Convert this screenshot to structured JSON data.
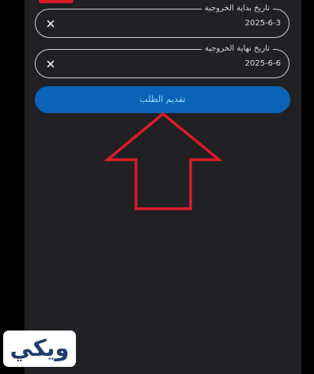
{
  "form": {
    "start_date": {
      "label": "تاريخ بداية الخروجية",
      "value": "2025-6-3",
      "clear_icon": "close-icon"
    },
    "end_date": {
      "label": "تاريخ نهاية الخروجية",
      "value": "2025-6-6",
      "clear_icon": "close-icon"
    },
    "submit_label": "تقديم الطلب"
  },
  "annotation": {
    "icon": "arrow-up-icon",
    "color": "#d81c2a"
  },
  "watermark": {
    "text": "ويكي"
  },
  "colors": {
    "background": "#000000",
    "panel": "#212024",
    "button": "#0a63b6",
    "button_text": "#9fd8ff",
    "field_border": "#cfcfd4",
    "accent_red": "#d81c2a"
  }
}
